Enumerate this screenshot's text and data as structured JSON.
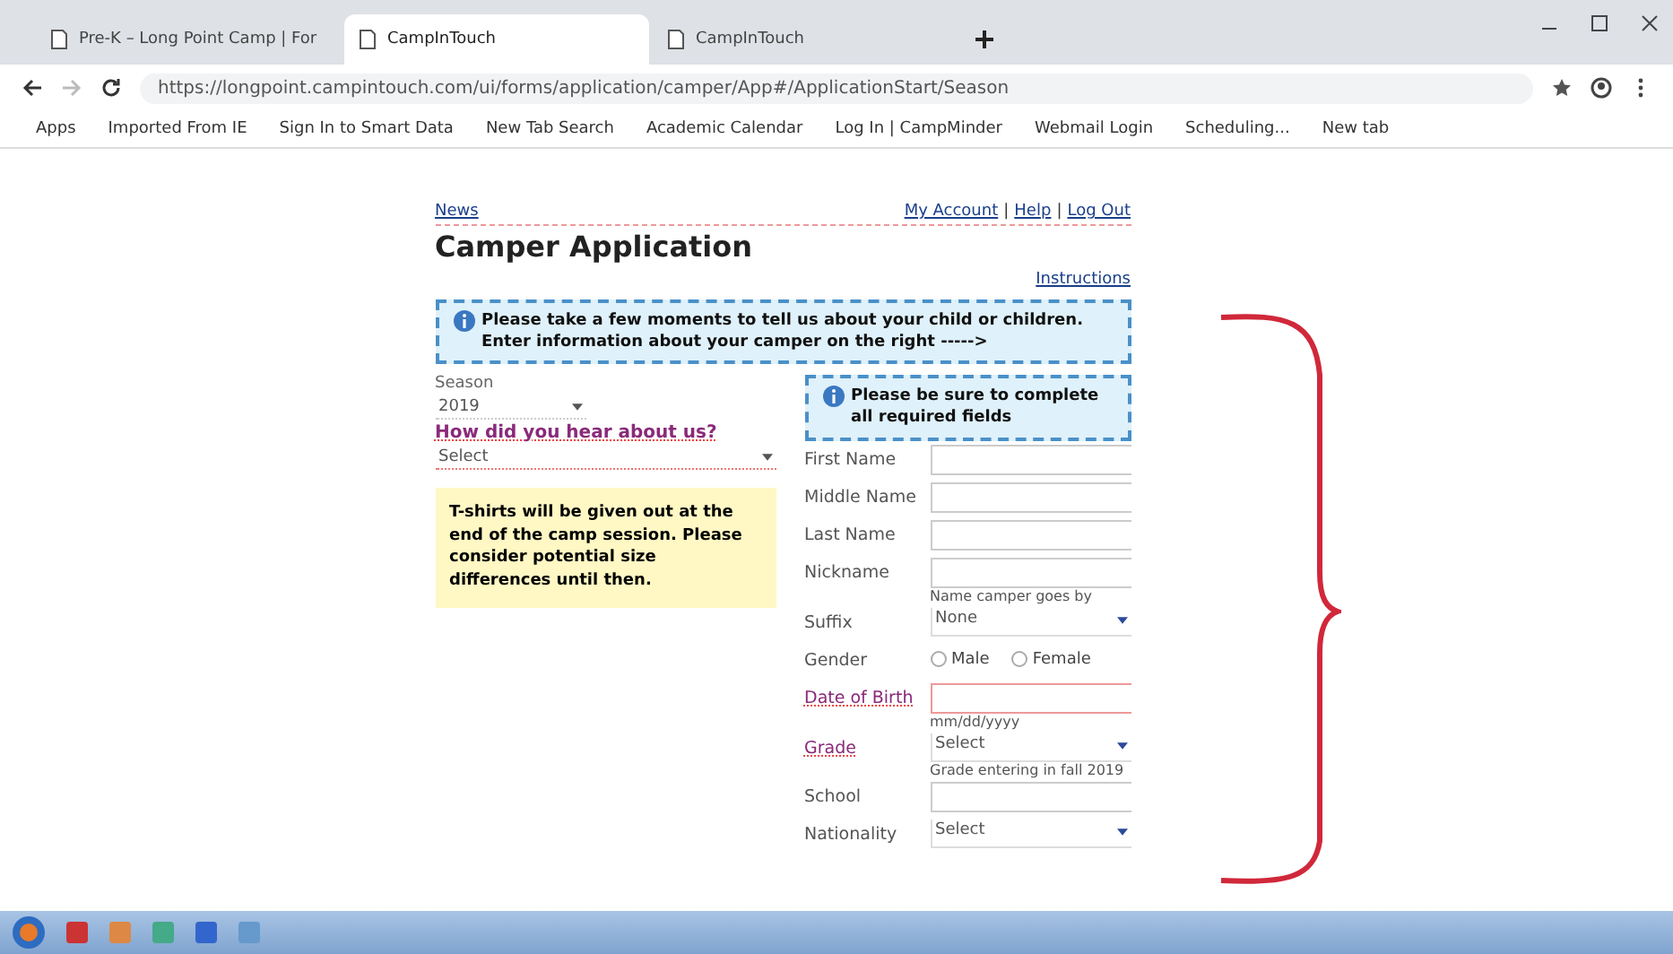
{
  "browser": {
    "tabs": [
      {
        "title": "Pre-K – Long Point Camp | For",
        "selected": false
      },
      {
        "title": "CampInTouch",
        "selected": true
      },
      {
        "title": "CampInTouch",
        "selected": false
      }
    ],
    "address": "https://longpoint.campintouch.com/ui/forms/application/camper/App#/ApplicationStart/Season",
    "bookmarks": [
      "Apps",
      "Imported From IE",
      "Sign In to Smart Data",
      "New Tab Search",
      "Academic Calendar",
      "Log In | CampMinder",
      "Webmail Login",
      "Scheduling...",
      "New tab"
    ]
  },
  "page": {
    "top_links": {
      "left": "News",
      "right": [
        {
          "kind": "link",
          "text": "My Account"
        },
        {
          "kind": "separator",
          "text": "|"
        },
        {
          "kind": "link",
          "text": "Help"
        },
        {
          "kind": "separator",
          "text": "|"
        },
        {
          "kind": "link",
          "text": "Log Out"
        }
      ]
    },
    "title": "Camper Application",
    "instructions_link": "Instructions",
    "intro_note": "Please take a few moments to tell us about your child or children. Enter information about your camper on the right ----->",
    "season": {
      "label": "Season",
      "value": "2019"
    },
    "referral": {
      "label": "How did you hear about us?",
      "value": "Select"
    },
    "tshirt_note": "T-shirts will be given out at the end of the camp session. Please consider potential size differences until then.",
    "required_note": "Please be sure to complete all required fields",
    "fields": [
      {
        "kind": "text",
        "label": "First Name",
        "required": false
      },
      {
        "kind": "text",
        "label": "Middle Name",
        "required": false
      },
      {
        "kind": "text",
        "label": "Last Name",
        "required": false
      },
      {
        "kind": "text",
        "label": "Nickname",
        "required": false,
        "hint": "Name camper goes by"
      },
      {
        "kind": "select",
        "label": "Suffix",
        "required": false,
        "value": "None"
      },
      {
        "kind": "radio",
        "label": "Gender",
        "required": false,
        "options": [
          {
            "label": "Male",
            "selected": false
          },
          {
            "label": "Female",
            "selected": false
          }
        ]
      },
      {
        "kind": "text",
        "label": "Date of Birth",
        "required": true,
        "hint": "mm/dd/yyyy"
      },
      {
        "kind": "select",
        "label": "Grade",
        "required": true,
        "value": "Select",
        "hint": "Grade entering in fall 2019"
      },
      {
        "kind": "text",
        "label": "School",
        "required": false
      },
      {
        "kind": "select",
        "label": "Nationality",
        "required": false,
        "value": "Select"
      }
    ]
  }
}
